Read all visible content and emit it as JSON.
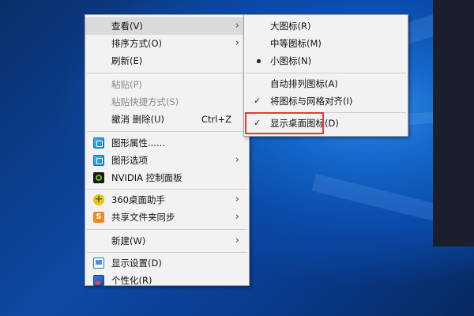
{
  "main_menu": {
    "view": "查看(V)",
    "sort": "排序方式(O)",
    "refresh": "刷新(E)",
    "paste": "粘贴(P)",
    "paste_shortcut": "粘贴快捷方式(S)",
    "undo": "撤消 删除(U)",
    "undo_key": "Ctrl+Z",
    "graphics_props": "图形属性......",
    "graphics_options": "图形选项",
    "nvidia": "NVIDIA 控制面板",
    "assistant_360": "360桌面助手",
    "share_sync": "共享文件夹同步",
    "new": "新建(W)",
    "display_settings": "显示设置(D)",
    "personalize": "个性化(R)"
  },
  "view_submenu": {
    "large_icons": "大图标(R)",
    "medium_icons": "中等图标(M)",
    "small_icons": "小图标(N)",
    "auto_arrange": "自动排列图标(A)",
    "align_grid": "将图标与网格对齐(I)",
    "show_desktop_icons": "显示桌面图标(D)"
  },
  "icons": {
    "graphics": "graphics-icon",
    "nvidia": "nvidia-icon",
    "assistant_360": "360-icon",
    "share": "share-sync-icon",
    "display": "display-icon",
    "personalize": "personalize-icon"
  },
  "colors": {
    "highlight_box": "#e23b3b",
    "menu_bg": "#f2f2f2",
    "desktop": "#0b3d91"
  },
  "state": {
    "selected_icon_size": "small_icons",
    "align_grid_checked": true,
    "show_desktop_icons_checked": true
  }
}
